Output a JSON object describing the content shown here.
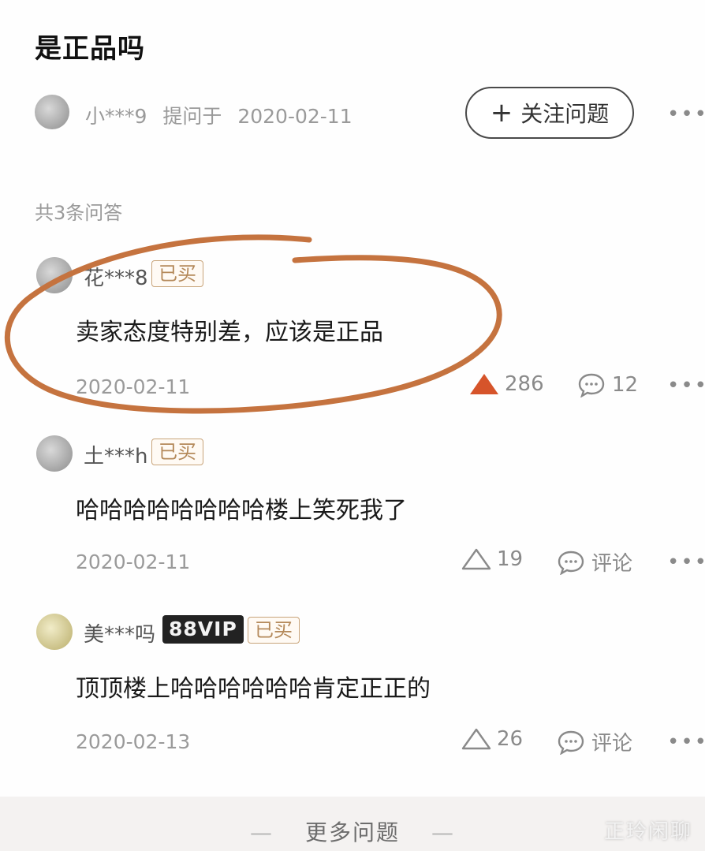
{
  "question": {
    "title": "是正品吗",
    "asker_name": "小***9",
    "asked_label": "提问于",
    "asked_date": "2020-02-11",
    "follow_label": "关注问题",
    "follow_icon": "plus-icon",
    "more_icon": "more-dots-icon"
  },
  "answer_count_label": "共3条问答",
  "answers": [
    {
      "user": "花***8",
      "badges": [
        "已买"
      ],
      "text": "卖家态度特别差，应该是正品",
      "date": "2020-02-11",
      "likes": "286",
      "likes_active": true,
      "comments": "12",
      "highlighted": true
    },
    {
      "user": "土***h",
      "badges": [
        "已买"
      ],
      "text": "哈哈哈哈哈哈哈哈楼上笑死我了",
      "date": "2020-02-11",
      "likes": "19",
      "likes_active": false,
      "comments": "评论",
      "highlighted": false
    },
    {
      "user": "美***吗",
      "vip": "88VIP",
      "badges": [
        "已买"
      ],
      "text": "顶顶楼上哈哈哈哈哈哈肯定正正的",
      "date": "2020-02-13",
      "likes": "26",
      "likes_active": false,
      "comments": "评论",
      "highlighted": false
    }
  ],
  "more_questions_label": "更多问题",
  "watermark": "正玲闲聊",
  "colors": {
    "like_active": "#d6542a",
    "badge_border": "#c8a47a",
    "highlight_oval": "#c5733f"
  }
}
